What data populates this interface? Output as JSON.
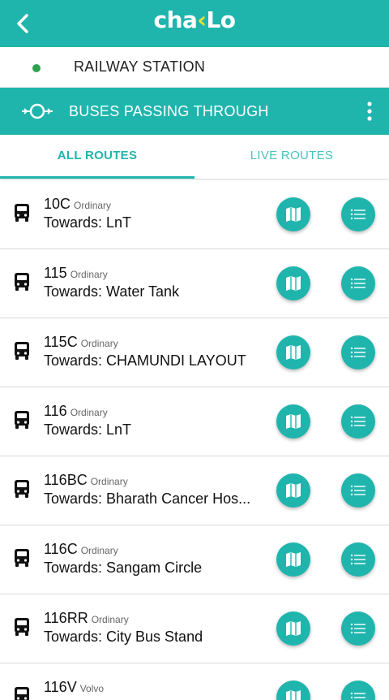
{
  "app": {
    "logo_part1": "cha",
    "logo_part2": "Lo"
  },
  "stop": {
    "name": "RAILWAY STATION"
  },
  "passing": {
    "title": "BUSES PASSING THROUGH"
  },
  "tabs": [
    {
      "label": "ALL ROUTES",
      "selected": true
    },
    {
      "label": "LIVE ROUTES",
      "selected": false
    }
  ],
  "routes": [
    {
      "number": "10C",
      "type": "Ordinary",
      "destination": "Towards: LnT"
    },
    {
      "number": "115",
      "type": "Ordinary",
      "destination": "Towards: Water Tank"
    },
    {
      "number": "115C",
      "type": "Ordinary",
      "destination": "Towards: CHAMUNDI LAYOUT"
    },
    {
      "number": "116",
      "type": "Ordinary",
      "destination": "Towards: LnT"
    },
    {
      "number": "116BC",
      "type": "Ordinary",
      "destination": "Towards: Bharath Cancer Hos..."
    },
    {
      "number": "116C",
      "type": "Ordinary",
      "destination": "Towards: Sangam Circle"
    },
    {
      "number": "116RR",
      "type": "Ordinary",
      "destination": "Towards: City Bus Stand"
    },
    {
      "number": "116V",
      "type": "Volvo",
      "destination": ""
    }
  ],
  "icons": {
    "back": "back-arrow-icon",
    "passing": "stop-pass-through-icon",
    "more": "more-vert-icon",
    "bus": "bus-icon",
    "map": "map-icon",
    "list": "list-icon"
  },
  "colors": {
    "primary": "#1fb5ad",
    "logo_accent": "#f5e233",
    "stop_dot": "#2fa24e"
  }
}
